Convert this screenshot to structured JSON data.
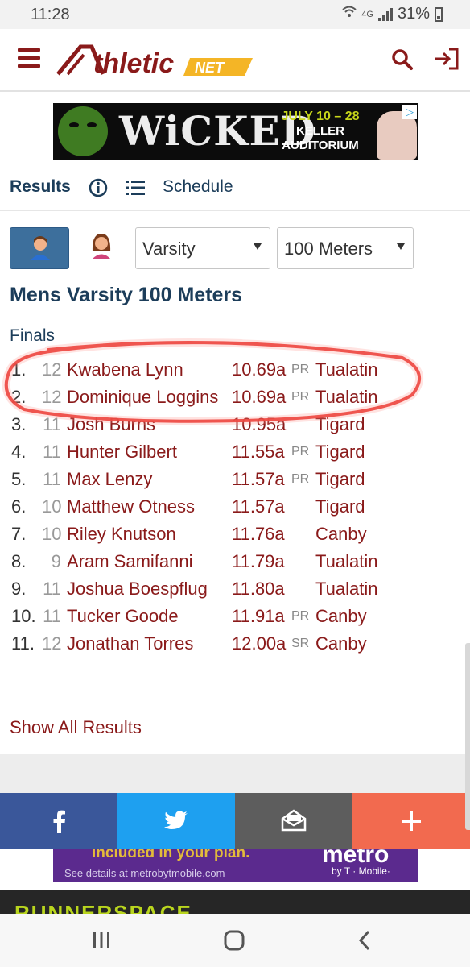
{
  "status_bar": {
    "time": "11:28",
    "network": "4G",
    "battery": "31%"
  },
  "header": {
    "logo_text": "thletic",
    "logo_net": "NET"
  },
  "ad_top": {
    "title": "WiCKED",
    "dates": "JULY 10 – 28",
    "venue_line1": "KELLER",
    "venue_line2": "AUDITORIUM"
  },
  "tabs": {
    "results": "Results",
    "schedule": "Schedule"
  },
  "filters": {
    "level": "Varsity",
    "event": "100 Meters"
  },
  "event_title": "Mens Varsity 100 Meters",
  "section": "Finals",
  "results": [
    {
      "place": "1.",
      "grade": "12",
      "name": "Kwabena Lynn",
      "time": "10.69a",
      "tag": "PR",
      "team": "Tualatin"
    },
    {
      "place": "2.",
      "grade": "12",
      "name": "Dominique Loggins",
      "time": "10.69a",
      "tag": "PR",
      "team": "Tualatin"
    },
    {
      "place": "3.",
      "grade": "11",
      "name": "Josh Burns",
      "time": "10.95a",
      "tag": "",
      "team": "Tigard"
    },
    {
      "place": "4.",
      "grade": "11",
      "name": "Hunter Gilbert",
      "time": "11.55a",
      "tag": "PR",
      "team": "Tigard"
    },
    {
      "place": "5.",
      "grade": "11",
      "name": "Max Lenzy",
      "time": "11.57a",
      "tag": "PR",
      "team": "Tigard"
    },
    {
      "place": "6.",
      "grade": "10",
      "name": "Matthew Otness",
      "time": "11.57a",
      "tag": "",
      "team": "Tigard"
    },
    {
      "place": "7.",
      "grade": "10",
      "name": "Riley Knutson",
      "time": "11.76a",
      "tag": "",
      "team": "Canby"
    },
    {
      "place": "8.",
      "grade": "9",
      "name": "Aram Samifanni",
      "time": "11.79a",
      "tag": "",
      "team": "Tualatin"
    },
    {
      "place": "9.",
      "grade": "11",
      "name": "Joshua Boespflug",
      "time": "11.80a",
      "tag": "",
      "team": "Tualatin"
    },
    {
      "place": "10.",
      "grade": "11",
      "name": "Tucker Goode",
      "time": "11.91a",
      "tag": "PR",
      "team": "Canby"
    },
    {
      "place": "11.",
      "grade": "12",
      "name": "Jonathan Torres",
      "time": "12.00a",
      "tag": "SR",
      "team": "Canby"
    }
  ],
  "show_all": "Show All Results",
  "ad_bottom": {
    "line1": "included in your plan.",
    "line2": "See details at metrobytmobile.com",
    "brand": "metro",
    "brand_sub": "by T · Mobile·"
  },
  "footer_banner": "RUNNERSPACE",
  "colors": {
    "brand": "#8a1a1a",
    "navy": "#1c3d5a",
    "facebook": "#3a579a",
    "twitter": "#1ea0f0",
    "email": "#5d5d5d",
    "more": "#f26a4f",
    "annotation": "#e8322b"
  }
}
